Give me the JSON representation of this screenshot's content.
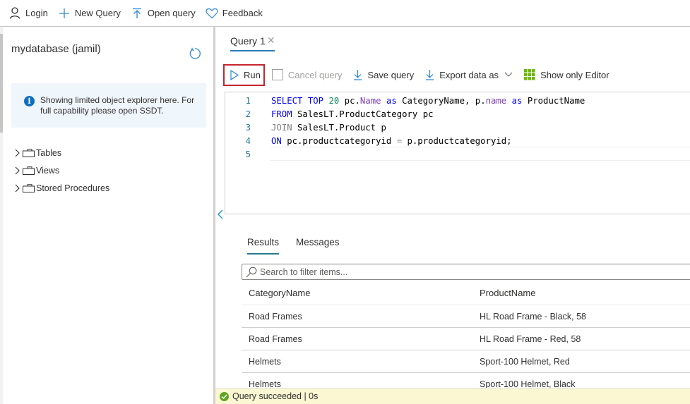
{
  "topbar": {
    "items": [
      {
        "label": "Login",
        "icon": "person-icon"
      },
      {
        "label": "New Query",
        "icon": "plus-icon"
      },
      {
        "label": "Open query",
        "icon": "upload-icon"
      },
      {
        "label": "Feedback",
        "icon": "heart-icon"
      }
    ]
  },
  "sidebar": {
    "database_title": "mydatabase (jamil)",
    "info_message": "Showing limited object explorer here. For full capability please open SSDT.",
    "tree": [
      {
        "label": "Tables"
      },
      {
        "label": "Views"
      },
      {
        "label": "Stored Procedures"
      }
    ]
  },
  "editor_tab": {
    "label": "Query 1",
    "close_glyph": "✕"
  },
  "toolbar": {
    "run_label": "Run",
    "cancel_label": "Cancel query",
    "save_label": "Save query",
    "export_label": "Export data as",
    "show_editor_label": "Show only Editor"
  },
  "editor": {
    "lines": [
      {
        "n": "1",
        "segments": [
          [
            "kw",
            "SELECT"
          ],
          [
            "t",
            " "
          ],
          [
            "kw",
            "TOP"
          ],
          [
            "t",
            " "
          ],
          [
            "num",
            "20"
          ],
          [
            "t",
            " pc."
          ],
          [
            "prop",
            "Name"
          ],
          [
            "t",
            " "
          ],
          [
            "kw",
            "as"
          ],
          [
            "t",
            " CategoryName, p."
          ],
          [
            "prop",
            "name"
          ],
          [
            "t",
            " "
          ],
          [
            "kw",
            "as"
          ],
          [
            "t",
            " ProductName"
          ]
        ]
      },
      {
        "n": "2",
        "segments": [
          [
            "kw",
            "FROM"
          ],
          [
            "t",
            " SalesLT.ProductCategory pc"
          ]
        ]
      },
      {
        "n": "3",
        "segments": [
          [
            "kwg",
            "JOIN"
          ],
          [
            "t",
            " SalesLT.Product p"
          ]
        ]
      },
      {
        "n": "4",
        "segments": [
          [
            "kw",
            "ON"
          ],
          [
            "t",
            " pc.productcategoryid "
          ],
          [
            "kwg",
            "="
          ],
          [
            "t",
            " p.productcategoryid;"
          ]
        ]
      },
      {
        "n": "5",
        "segments": []
      }
    ],
    "colors": {
      "keyword": "#0000ff",
      "operator": "#808080",
      "number": "#09885a",
      "property": "#7b3fb8"
    }
  },
  "results": {
    "tabs": [
      {
        "label": "Results",
        "active": true
      },
      {
        "label": "Messages",
        "active": false
      }
    ],
    "search_placeholder": "Search to filter items...",
    "columns": [
      "CategoryName",
      "ProductName"
    ],
    "rows": [
      [
        "Road Frames",
        "HL Road Frame - Black, 58"
      ],
      [
        "Road Frames",
        "HL Road Frame - Red, 58"
      ],
      [
        "Helmets",
        "Sport-100 Helmet, Red"
      ],
      [
        "Helmets",
        "Sport-100 Helmet, Black"
      ]
    ]
  },
  "status": {
    "message": "Query succeeded | 0s",
    "color": "#5ea51e"
  }
}
